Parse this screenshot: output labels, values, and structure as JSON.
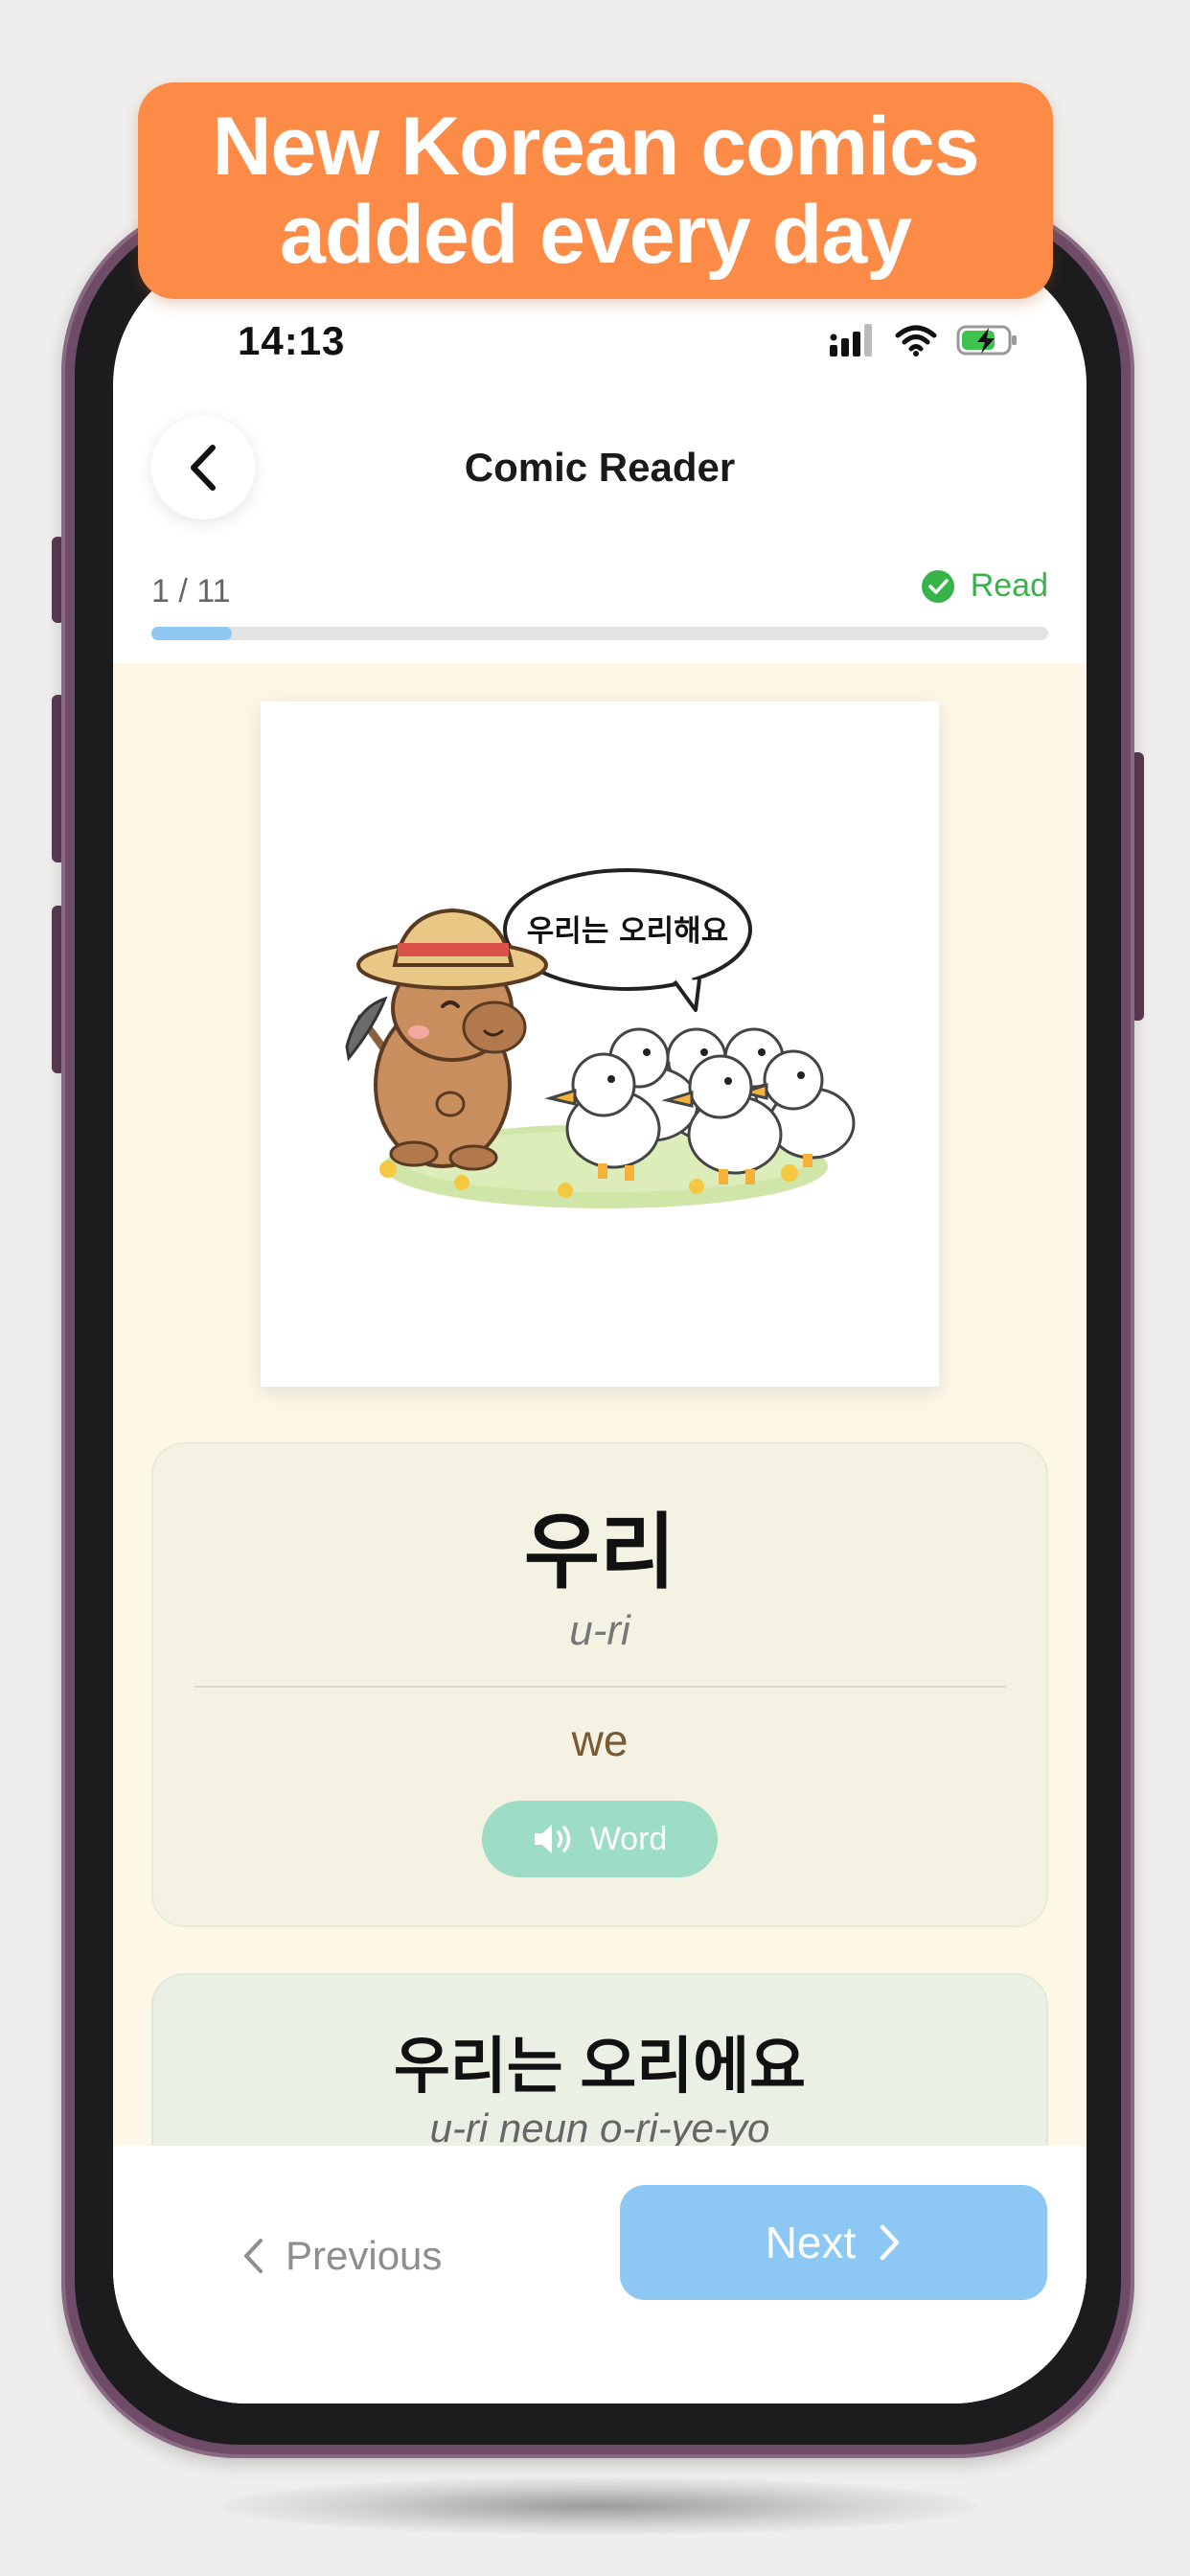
{
  "banner": {
    "line1": "New Korean comics",
    "line2": "added every day"
  },
  "status_bar": {
    "time": "14:13",
    "icons": [
      "cellular-signal-icon",
      "wifi-icon",
      "battery-charging-icon"
    ]
  },
  "header": {
    "title": "Comic Reader",
    "back_icon": "chevron-left-icon"
  },
  "progress": {
    "page_label": "1 / 11",
    "current": 1,
    "total": 11,
    "fraction": 0.09,
    "read_label": "Read",
    "read_icon": "check-circle-icon"
  },
  "comic": {
    "speech_bubble": "우리는 오리해요"
  },
  "word_card": {
    "korean": "우리",
    "romanization": "u-ri",
    "meaning": "we",
    "audio_label": "Word",
    "audio_icon": "speaker-icon"
  },
  "sentence_card": {
    "korean": "우리는 오리에요",
    "romanization": "u-ri neun o-ri-ye-yo"
  },
  "navigation": {
    "previous_label": "Previous",
    "next_label": "Next"
  },
  "colors": {
    "banner": "#fb8b47",
    "progress_fill": "#8fc9f1",
    "read_green": "#38b34a",
    "audio_button": "#9ddcc5",
    "next_button": "#8cc8f3",
    "content_background": "#fdf7e8",
    "phone_frame": "#6e4b66"
  }
}
